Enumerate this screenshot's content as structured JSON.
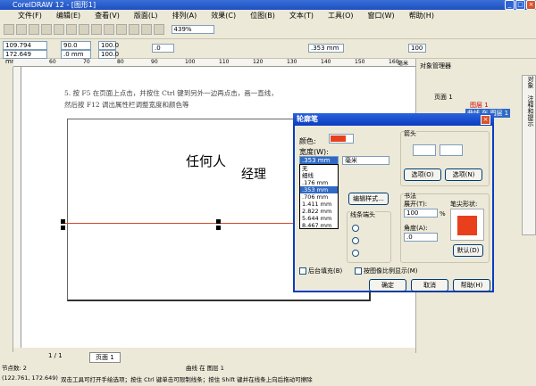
{
  "window": {
    "title": "CorelDRAW 12 - [图形1]"
  },
  "menu": [
    "文件(F)",
    "编辑(E)",
    "查看(V)",
    "版面(L)",
    "排列(A)",
    "效果(C)",
    "位图(B)",
    "文本(T)",
    "工具(O)",
    "窗口(W)",
    "帮助(H)"
  ],
  "toolbar": {
    "zoom": "439%"
  },
  "propbar": {
    "x": "109.794 mm",
    "y": "172.649 mm",
    "w": "90.0 mm",
    "h": ".0 mm",
    "sx": "100.0",
    "sy": "100.0",
    "pct": "%",
    "angle": ".0",
    "outline_width": ".353 mm",
    "smooth": "100"
  },
  "ruler": {
    "ticks": [
      "60",
      "70",
      "80",
      "90",
      "100",
      "110",
      "120",
      "130",
      "140",
      "150",
      "160"
    ],
    "unit": "毫米"
  },
  "canvas": {
    "instruction_line1": "5. 按 F5 在页面上点击，并按住 Ctrl 键到另外一边再点击，画一直线，",
    "instruction_line2": "然后按 F12 调出属性栏调整宽度和颜色等",
    "text1": "任何人",
    "text2": "经理",
    "line_color": "#d04a2a"
  },
  "docker": {
    "title": "对象管理器",
    "page": "页面 1",
    "layer": "图层 1",
    "selected": "曲线 在 图层 1",
    "side_tabs": [
      "对象",
      "注释和提示"
    ]
  },
  "dialog": {
    "title": "轮廓笔",
    "color_label": "颜色:",
    "color": "#e8401c",
    "width_label": "宽度(W):",
    "width_value": ".353 mm",
    "unit": "毫米",
    "width_options": [
      "无",
      "细线",
      ".176 mm",
      ".353 mm",
      ".706 mm",
      "1.411 mm",
      "2.822 mm",
      "5.644 mm",
      "8.467 mm"
    ],
    "selected_index": 3,
    "edit_style": "编辑样式...",
    "line_caps": "线条端头",
    "arrows": "箭头",
    "options1": "选项(O)",
    "options2": "选项(N)",
    "calligraphy": "书法",
    "stretch_label": "展开(T):",
    "stretch": "100",
    "pct": "%",
    "angle_label": "角度(A):",
    "angle": ".0",
    "nib_label": "笔尖形状:",
    "default": "默认(D)",
    "behind_fill": "后台填充(B)",
    "scale_with_image": "按图像比例显示(M)",
    "ok": "确定",
    "cancel": "取消",
    "help": "帮助(H)"
  },
  "pager": {
    "pages": "1 / 1",
    "tab": "页面 1"
  },
  "status": {
    "nodes": "节点数: 2",
    "object": "曲线 在 图层 1",
    "coords": "(122.761, 172.649)",
    "hint": "双击工具可打开手绘选项；按住 Ctrl 键单击可限制线条；按住 Shift 键并在线条上向后拖动可擦除"
  }
}
